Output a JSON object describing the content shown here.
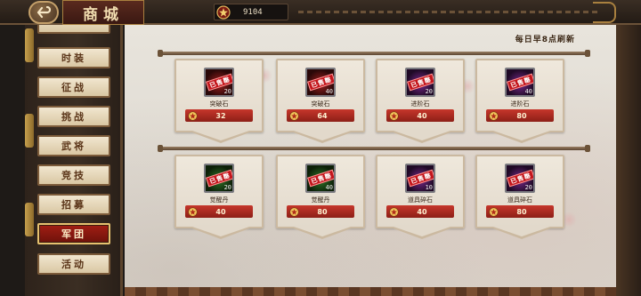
{
  "header": {
    "title": "商城",
    "currency_value": "9104"
  },
  "sidebar": {
    "items": [
      {
        "label": "时装",
        "active": false
      },
      {
        "label": "征战",
        "active": false
      },
      {
        "label": "挑战",
        "active": false
      },
      {
        "label": "武将",
        "active": false
      },
      {
        "label": "竞技",
        "active": false
      },
      {
        "label": "招募",
        "active": false
      },
      {
        "label": "军团",
        "active": true
      },
      {
        "label": "活动",
        "active": false
      }
    ]
  },
  "shop": {
    "refresh_text": "每日早8点刷新",
    "sold_label": "已售罄",
    "items": [
      {
        "name": "突破石",
        "count": "20",
        "price": "32",
        "glow": "red"
      },
      {
        "name": "突破石",
        "count": "40",
        "price": "64",
        "glow": "red"
      },
      {
        "name": "进阶石",
        "count": "20",
        "price": "40",
        "glow": "purple"
      },
      {
        "name": "进阶石",
        "count": "40",
        "price": "80",
        "glow": "purple"
      },
      {
        "name": "觉醒丹",
        "count": "20",
        "price": "40",
        "glow": "green"
      },
      {
        "name": "觉醒丹",
        "count": "40",
        "price": "80",
        "glow": "green"
      },
      {
        "name": "道具碎石",
        "count": "10",
        "price": "40",
        "glow": "purple"
      },
      {
        "name": "道具碎石",
        "count": "20",
        "price": "80",
        "glow": "purple"
      }
    ]
  },
  "colors": {
    "accent_red": "#c6362b",
    "active_nav": "#a21e14",
    "gold": "#c4a06a"
  }
}
